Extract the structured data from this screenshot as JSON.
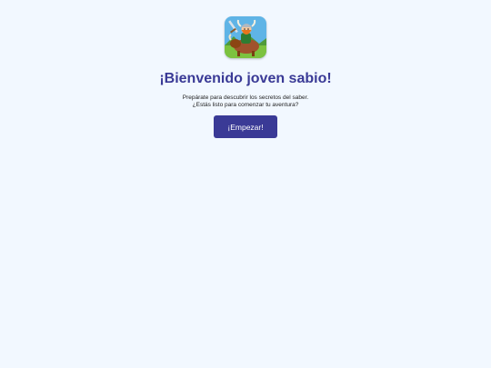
{
  "welcome": {
    "logo_icon": "viking-riding-bull-logo-icon",
    "title": "¡Bienvenido joven sabio!",
    "subtitle_line1": "Prepárate para descubrir los secretos del saber.",
    "subtitle_line2": "¿Estás listo para comenzar tu aventura?",
    "start_button_label": "¡Empezar!"
  },
  "colors": {
    "background": "#f2f8ff",
    "accent": "#3a3a96",
    "button_text": "#ffffff"
  }
}
